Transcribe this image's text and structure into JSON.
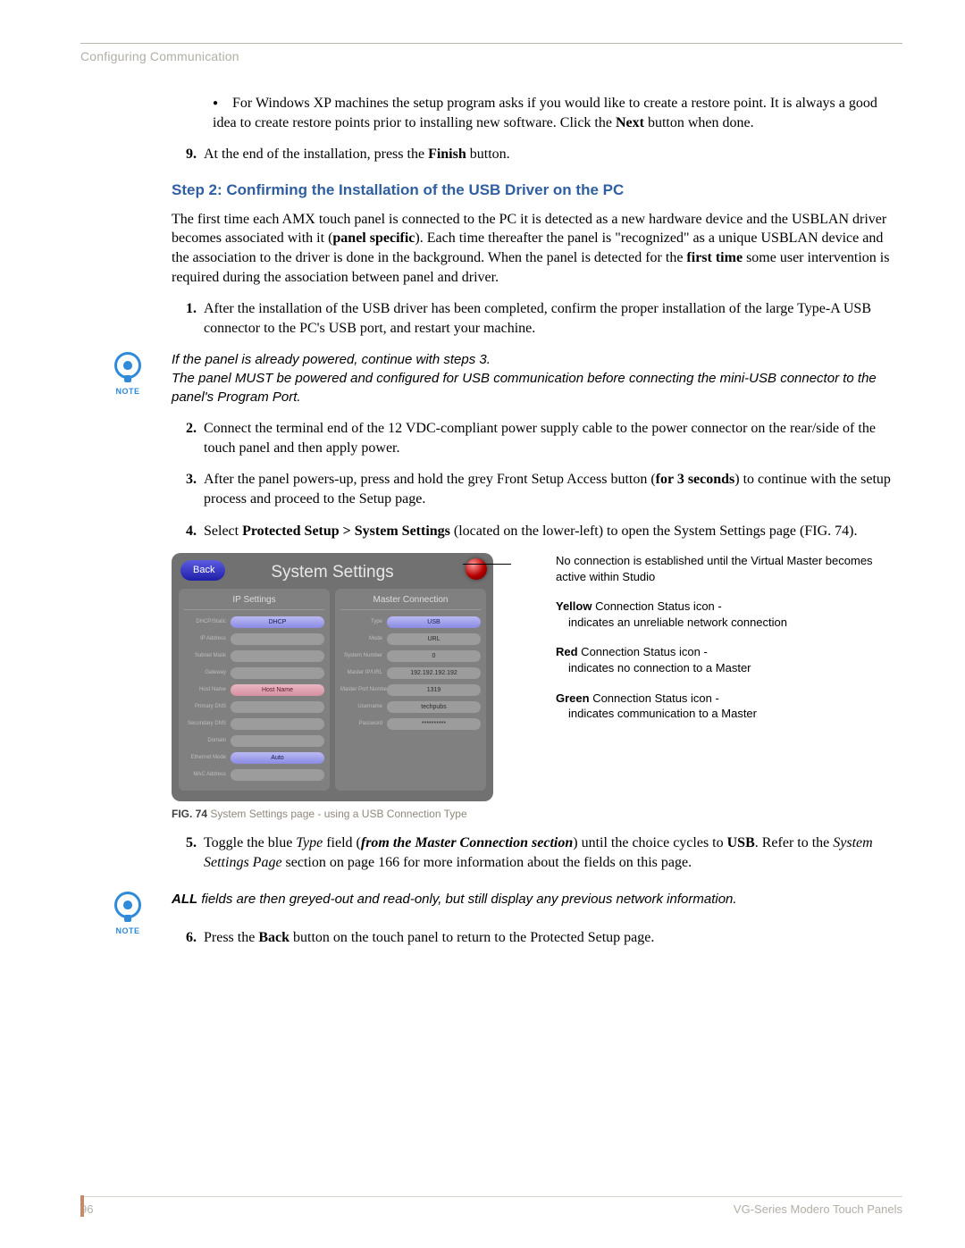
{
  "header": {
    "section": "Configuring Communication"
  },
  "intro": {
    "bullet": {
      "line1": "For Windows XP machines the setup program asks if you would like to create a restore point. It is always a good idea to create restore points prior to installing new software. Click the ",
      "bold1": "Next",
      "line1b": " button when done."
    }
  },
  "step9": {
    "num": "9.",
    "text_a": "At the end of the installation, press the ",
    "bold": "Finish",
    "text_b": " button."
  },
  "step2_heading": "Step 2: Confirming the Installation of the USB Driver on the PC",
  "para1_a": "The first time each AMX touch panel is connected to the PC it is detected as a new hardware device and the USBLAN driver becomes associated with it (",
  "para1_bold1": "panel specific",
  "para1_b": "). Each time thereafter the panel is \"recognized\" as a unique USBLAN device and the association to the driver is done in the background. When the panel is detected for the ",
  "para1_bold2": "first time",
  "para1_c": " some user intervention is required during the association between panel and driver.",
  "list": [
    {
      "num": "1.",
      "text": "After the installation of the USB driver has been completed, confirm the proper installation of the large Type-A USB connector to the PC's USB port, and restart your machine."
    },
    {
      "num": "2.",
      "text": "Connect the terminal end of the 12 VDC-compliant power supply cable to the power connector on the rear/side of the touch panel and then apply power."
    },
    {
      "num": "3.",
      "text_a": "After the panel powers-up, press and hold the grey Front Setup Access button (",
      "bold": "for 3 seconds",
      "text_b": ") to continue with the setup process and proceed to the Setup page."
    },
    {
      "num": "4.",
      "text_a": "Select ",
      "bold": "Protected Setup > System Settings",
      "text_b": " (located on the lower-left) to open the System Settings page (FIG. 74)."
    },
    {
      "num": "5.",
      "text_a": "Toggle the blue ",
      "ital1": "Type",
      "text_b": " field (",
      "bolditalic": "from the Master Connection section",
      "text_c": ") until the choice cycles to ",
      "bold2": "USB",
      "text_d": ". Refer to the ",
      "ital2": "System Settings Page",
      "text_e": " section on page 166 for more information about the fields on this page."
    },
    {
      "num": "6.",
      "text_a": "Press the ",
      "bold": "Back",
      "text_b": " button on the touch panel to return to the Protected Setup page."
    }
  ],
  "note1": {
    "label": "NOTE",
    "l1": "If the panel is already powered, continue with steps 3.",
    "l2": "The panel MUST be powered and configured for USB communication before connecting the mini-USB connector to the panel's Program Port."
  },
  "note2": {
    "label": "NOTE",
    "l1_a": "ALL",
    "l1_b": " fields are then greyed-out and read-only, but still display any previous network information."
  },
  "figure": {
    "back": "Back",
    "title": "System Settings",
    "col_left_h": "IP Settings",
    "col_right_h": "Master Connection",
    "left_rows": [
      {
        "lbl": "DHCP/Static",
        "val": "DHCP",
        "cls": "blue"
      },
      {
        "lbl": "IP Address",
        "val": "",
        "cls": ""
      },
      {
        "lbl": "Subnet Mask",
        "val": "",
        "cls": ""
      },
      {
        "lbl": "Gateway",
        "val": "",
        "cls": ""
      },
      {
        "lbl": "Host Name",
        "val": "Host Name",
        "cls": "red"
      },
      {
        "lbl": "Primary DNS",
        "val": "",
        "cls": ""
      },
      {
        "lbl": "Secondary DNS",
        "val": "",
        "cls": ""
      },
      {
        "lbl": "Domain",
        "val": "",
        "cls": ""
      },
      {
        "lbl": "Ethernet Mode",
        "val": "Auto",
        "cls": "blue"
      },
      {
        "lbl": "MAC Address",
        "val": "",
        "cls": ""
      }
    ],
    "right_rows": [
      {
        "lbl": "Type",
        "val": "USB",
        "cls": "blue"
      },
      {
        "lbl": "Mode",
        "val": "URL",
        "cls": ""
      },
      {
        "lbl": "System Number",
        "val": "0",
        "cls": ""
      },
      {
        "lbl": "Master IP/URL",
        "val": "192.192.192.192",
        "cls": ""
      },
      {
        "lbl": "Master Port Number",
        "val": "1319",
        "cls": ""
      },
      {
        "lbl": "Username",
        "val": "techpubs",
        "cls": ""
      },
      {
        "lbl": "Password",
        "val": "**********",
        "cls": ""
      }
    ],
    "caption_prefix": "FIG. 74",
    "caption": "  System Settings page - using a USB Connection Type",
    "callouts": {
      "c1": "No connection is established until the Virtual Master becomes active within Studio",
      "c2_bold": "Yellow",
      "c2": " Connection Status icon - ",
      "c2b": "indicates an unreliable network connection",
      "c3_bold": "Red",
      "c3": " Connection Status icon - ",
      "c3b": "indicates no connection to a Master",
      "c4_bold": "Green",
      "c4": " Connection Status icon - ",
      "c4b": "indicates communication to a Master"
    }
  },
  "footer": {
    "page": "96",
    "title": "VG-Series Modero Touch Panels"
  }
}
